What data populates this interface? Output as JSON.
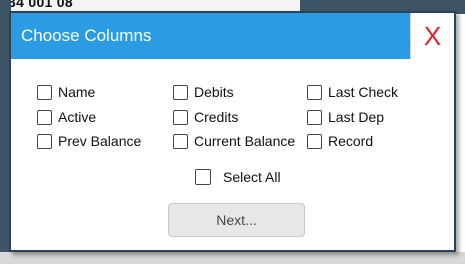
{
  "background": {
    "partial_text": "34 001 08"
  },
  "dialog": {
    "title": "Choose Columns",
    "close_label": "X",
    "columns": [
      {
        "label": "Name",
        "checked": false
      },
      {
        "label": "Active",
        "checked": false
      },
      {
        "label": "Prev Balance",
        "checked": false
      },
      {
        "label": "Debits",
        "checked": false
      },
      {
        "label": "Credits",
        "checked": false
      },
      {
        "label": "Current Balance",
        "checked": false
      },
      {
        "label": "Last Check",
        "checked": false
      },
      {
        "label": "Last Dep",
        "checked": false
      },
      {
        "label": "Record",
        "checked": false
      }
    ],
    "select_all_label": "Select All",
    "next_label": "Next..."
  },
  "colors": {
    "titlebar": "#2b9be3",
    "close_x": "#e0202a",
    "border": "#2c4258"
  }
}
